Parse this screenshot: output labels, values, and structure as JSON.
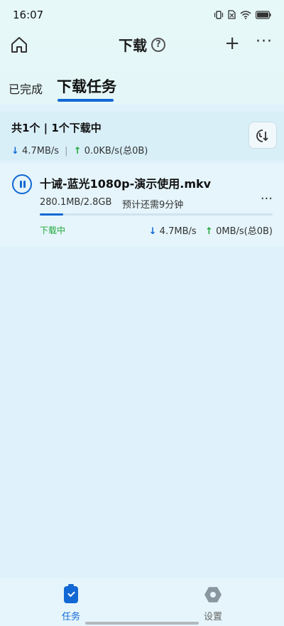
{
  "status_bar": {
    "time": "16:07"
  },
  "header": {
    "title": "下载",
    "help_glyph": "?",
    "add_glyph": "+",
    "more_glyph": "···"
  },
  "tabs": [
    {
      "label": "已完成",
      "active": false
    },
    {
      "label": "下载任务",
      "active": true
    }
  ],
  "summary": {
    "count_text": "共1个 | 1个下载中",
    "download_arrow": "↓",
    "download_speed": "4.7MB/s",
    "separator": "|",
    "upload_arrow": "↑",
    "upload_speed": "0.0KB/s(总0B)"
  },
  "tasks": [
    {
      "file_name": "十诫-蓝光1080p-演示使用.mkv",
      "size_progress": "280.1MB/2.8GB",
      "eta": "预计还需9分钟",
      "progress": 0.1,
      "status": "下载中",
      "download_arrow": "↓",
      "download_speed": "4.7MB/s",
      "upload_arrow": "↑",
      "upload_speed": "0MB/s(总0B)",
      "more_glyph": "···"
    }
  ],
  "bottom_nav": [
    {
      "label": "任务",
      "icon": "clipboard-check-icon",
      "active": true
    },
    {
      "label": "设置",
      "icon": "gear-icon",
      "active": false
    }
  ],
  "colors": {
    "accent": "#1268d4",
    "green": "#1fa83a",
    "background": "#dff1fb"
  }
}
